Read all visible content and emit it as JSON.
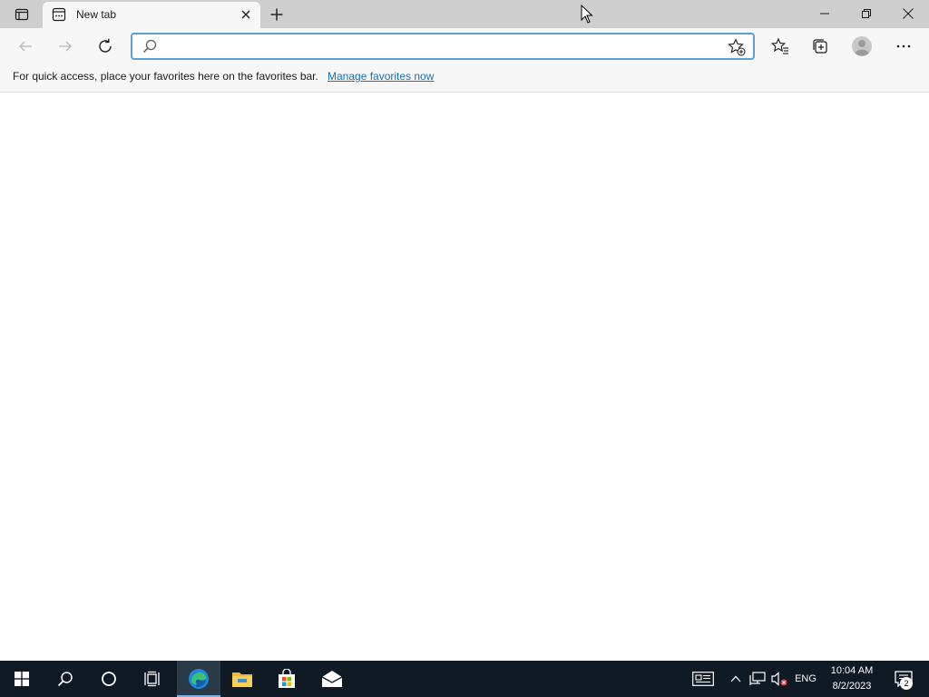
{
  "tab": {
    "title": "New tab"
  },
  "address_bar": {
    "value": "",
    "placeholder": ""
  },
  "favorites_bar": {
    "message": "For quick access, place your favorites here on the favorites bar.",
    "link_label": "Manage favorites now"
  },
  "taskbar": {
    "language": "ENG",
    "time": "10:04 AM",
    "date": "8/2/2023",
    "notification_count": "2"
  },
  "icons": [
    "tab-actions-icon",
    "page-icon",
    "close-icon",
    "plus-icon",
    "minimize-icon",
    "restore-icon",
    "close-window-icon",
    "back-icon",
    "forward-icon",
    "refresh-icon",
    "search-icon",
    "add-favorite-icon",
    "favorites-icon",
    "collections-icon",
    "profile-icon",
    "more-icon",
    "windows-start-icon",
    "search-taskbar-icon",
    "cortana-icon",
    "task-view-icon",
    "edge-icon",
    "file-explorer-icon",
    "store-icon",
    "mail-icon",
    "news-icon",
    "chevron-up-icon",
    "network-icon",
    "volume-muted-icon",
    "notifications-icon"
  ],
  "colors": {
    "accent": "#5e9fd9",
    "link": "#1a6fb6",
    "taskbar": "#101a24"
  }
}
